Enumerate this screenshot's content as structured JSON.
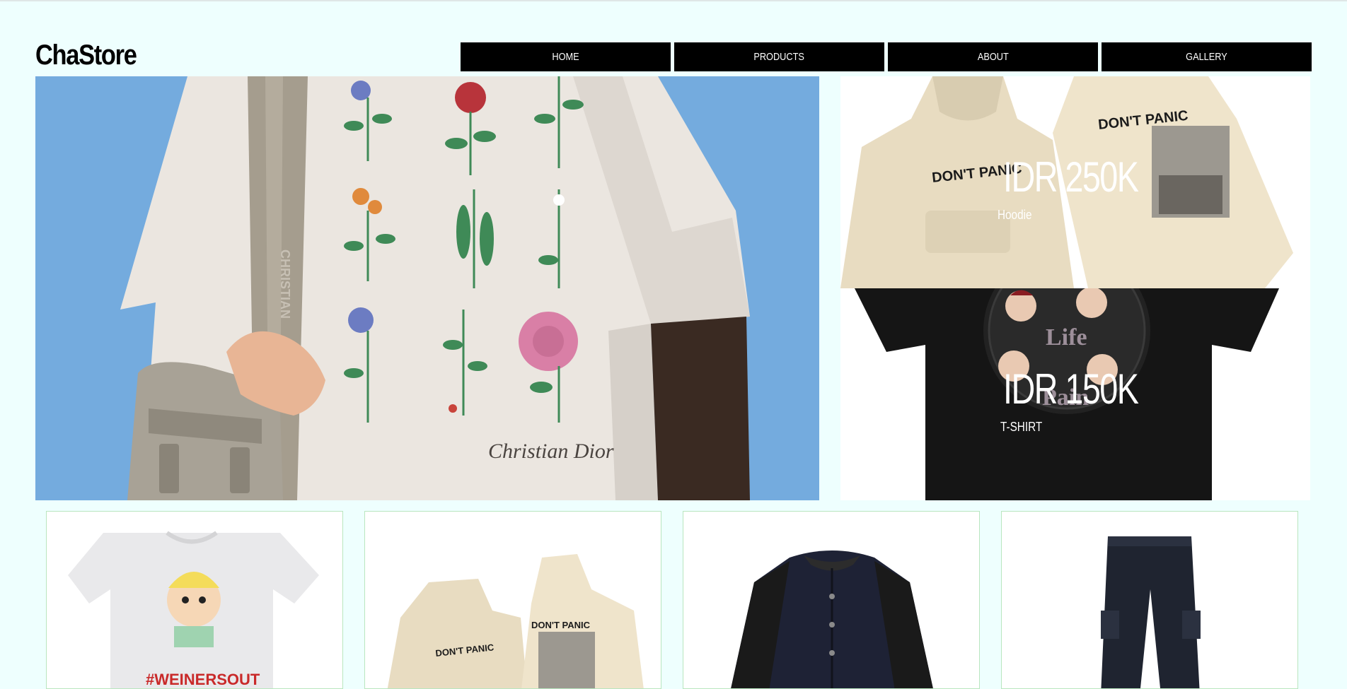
{
  "brand": {
    "name": "ChaStore"
  },
  "nav": {
    "items": [
      "HOME",
      "PRODUCTS",
      "ABOUT",
      "GALLERY"
    ]
  },
  "hero": {
    "image_icon": "hero-tshirt-image",
    "print_signature": "Christian Dior",
    "strap_text": "CHRISTIAN"
  },
  "promos": [
    {
      "price": "IDR 250K",
      "name": "Hoodie",
      "image_icon": "hoodie-image",
      "shirt_text": "DON'T PANIC"
    },
    {
      "price": "IDR 150K",
      "name": "T-SHIRT",
      "image_icon": "tshirt-image"
    }
  ],
  "products": [
    {
      "image_icon": "white-tshirt-image",
      "shirt_text": "#WEINERSOUT"
    },
    {
      "image_icon": "hoodie-image",
      "shirt_text": "DON'T PANIC"
    },
    {
      "image_icon": "varsity-jacket-image"
    },
    {
      "image_icon": "cargo-pants-image"
    }
  ],
  "colors": {
    "background": "#eefffe",
    "nav_bg": "#000000",
    "nav_text": "#ffffff",
    "card_border": "#b9e6bf",
    "hero_sky": "#6fa6da"
  }
}
